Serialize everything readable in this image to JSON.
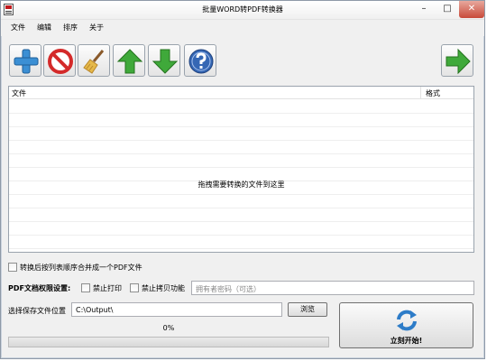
{
  "window": {
    "title": "批量WORD转PDF转换器",
    "controls": {
      "minimize": "–",
      "maximize": "□",
      "close": "✕"
    }
  },
  "menu": {
    "items": [
      "文件",
      "编辑",
      "排序",
      "关于"
    ]
  },
  "toolbar": {
    "buttons": [
      {
        "icon": "add-icon"
      },
      {
        "icon": "remove-icon"
      },
      {
        "icon": "broom-icon"
      },
      {
        "icon": "arrow-up-icon"
      },
      {
        "icon": "arrow-down-icon"
      },
      {
        "icon": "help-icon"
      },
      {
        "icon": "arrow-right-icon"
      }
    ]
  },
  "file_list": {
    "columns": [
      "文件",
      "格式"
    ],
    "rows": [],
    "placeholder": "拖拽需要转换的文件到这里"
  },
  "merge": {
    "label": "转换后按列表顺序合并成一个PDF文件",
    "checked": false
  },
  "permissions": {
    "label": "PDF文档权限设置:",
    "no_print": {
      "label": "禁止打印",
      "checked": false
    },
    "no_copy": {
      "label": "禁止拷贝功能",
      "checked": false
    },
    "password": {
      "value": "",
      "placeholder": "拥有者密码（可选）"
    }
  },
  "output": {
    "label": "选择保存文件位置",
    "path": "C:\\Output\\",
    "browse_label": "浏览"
  },
  "progress": {
    "text": "0%",
    "value": 0
  },
  "start": {
    "label": "立刻开始!",
    "icon": "refresh-icon"
  },
  "colors": {
    "add": "#3b8fd4",
    "remove": "#d42a2a",
    "arrow_green": "#3fa93a",
    "help": "#3567b4",
    "refresh": "#2d7cc8",
    "progress": "#39b54a"
  }
}
